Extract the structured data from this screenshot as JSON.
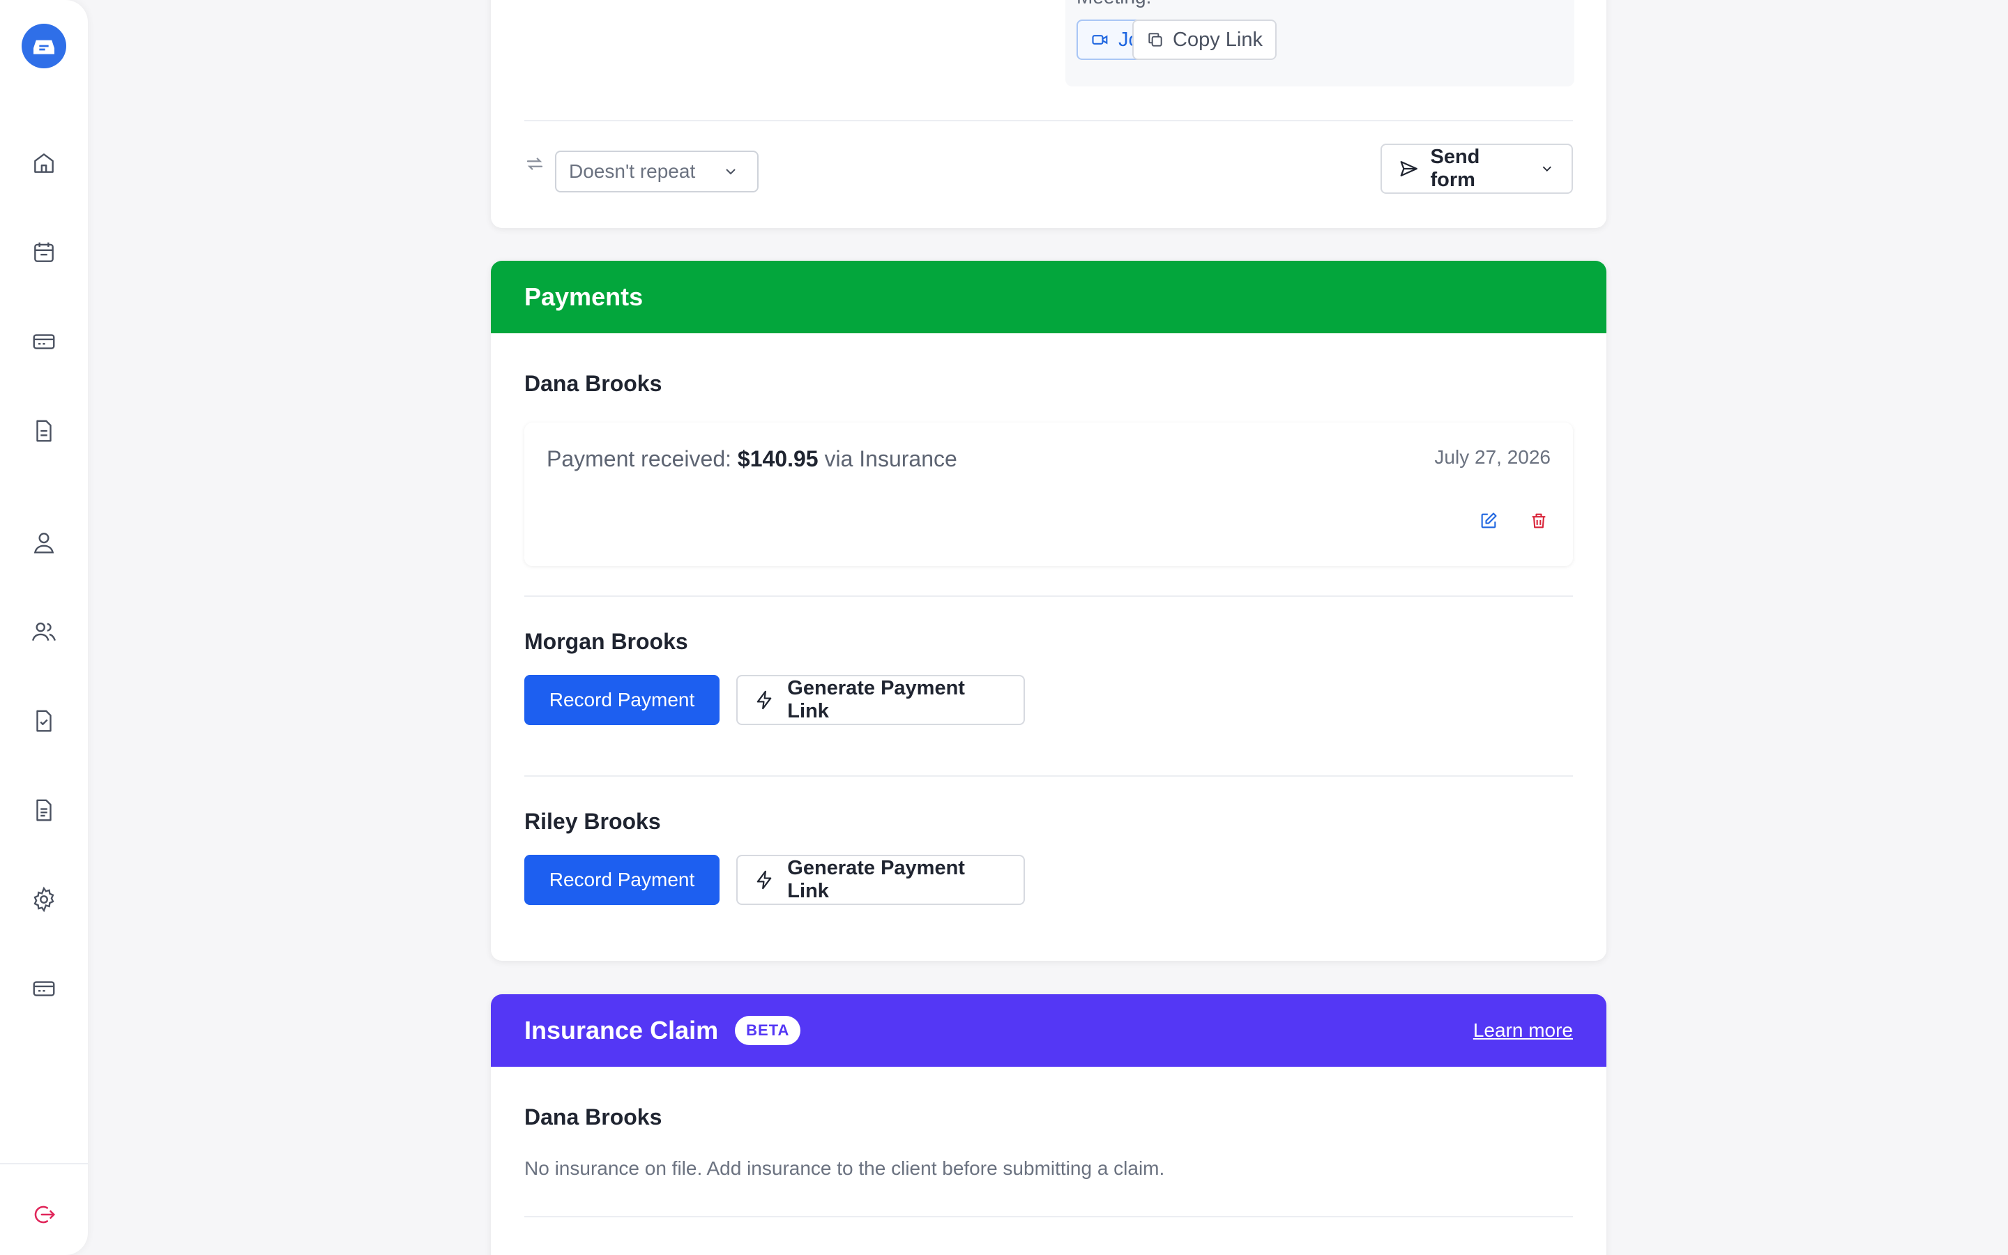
{
  "meeting": {
    "label": "Meeting:",
    "join_label": "Join",
    "copy_label": "Copy Link"
  },
  "repeat": {
    "selected": "Doesn't repeat"
  },
  "send_form": {
    "label": "Send form"
  },
  "payments": {
    "title": "Payments",
    "received": {
      "client": "Dana Brooks",
      "prefix": "Payment received:",
      "amount": "$140.95",
      "suffix": "via Insurance",
      "date": "July 27, 2026"
    },
    "pending": [
      {
        "client": "Morgan Brooks",
        "record_label": "Record Payment",
        "generate_label": "Generate Payment Link"
      },
      {
        "client": "Riley Brooks",
        "record_label": "Record Payment",
        "generate_label": "Generate Payment Link"
      }
    ]
  },
  "insurance": {
    "title": "Insurance Claim",
    "badge": "BETA",
    "learn_more": "Learn more",
    "client": "Dana Brooks",
    "message": "No insurance on file. Add insurance to the client before submitting a claim."
  },
  "colors": {
    "primary": "#1d5ff0",
    "payments_header": "#03a63c",
    "insurance_header": "#5437f5",
    "delete": "#d9253a"
  }
}
